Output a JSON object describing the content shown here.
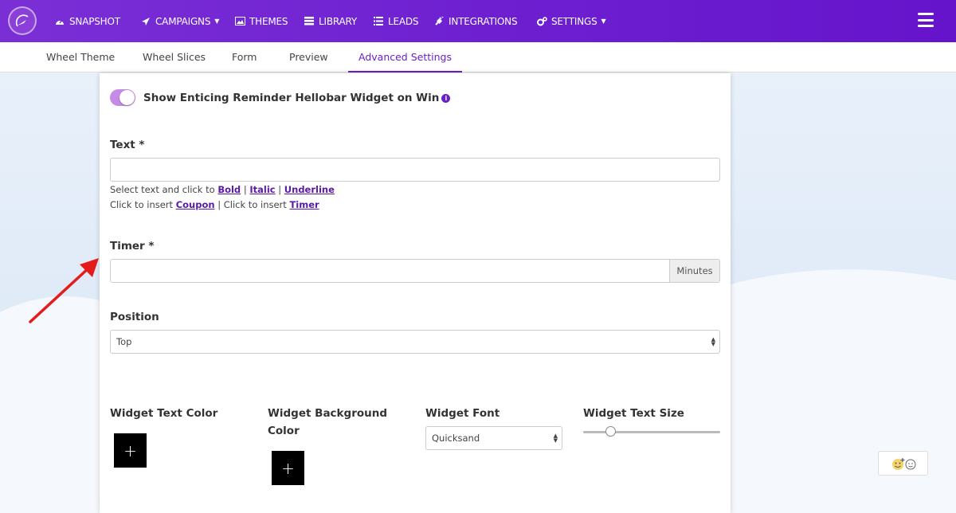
{
  "nav": {
    "items": [
      {
        "label": "SNAPSHOT",
        "icon": "dashboard-icon"
      },
      {
        "label": "CAMPAIGNS",
        "icon": "paper-plane-icon",
        "dropdown": true
      },
      {
        "label": "THEMES",
        "icon": "image-icon"
      },
      {
        "label": "LIBRARY",
        "icon": "list-icon"
      },
      {
        "label": "LEADS",
        "icon": "list-lines-icon"
      },
      {
        "label": "INTEGRATIONS",
        "icon": "plug-icon"
      },
      {
        "label": "SETTINGS",
        "icon": "gears-icon",
        "dropdown": true
      }
    ]
  },
  "tabs": {
    "items": [
      {
        "label": "Wheel Theme"
      },
      {
        "label": "Wheel Slices"
      },
      {
        "label": "Form"
      },
      {
        "label": "Preview"
      },
      {
        "label": "Advanced Settings",
        "active": true
      }
    ]
  },
  "form": {
    "toggle_label": "Show Enticing Reminder Hellobar Widget on Win",
    "info_glyph": "i",
    "text": {
      "label": "Text *",
      "value": "",
      "helper1_prefix": "Select text and click to ",
      "bold": "Bold",
      "italic": "Italic",
      "underline": "Underline",
      "separator": " | ",
      "helper2_prefix": "Click to insert ",
      "coupon": "Coupon",
      "helper2_mid": " | Click to insert ",
      "timer": "Timer"
    },
    "timer": {
      "label": "Timer *",
      "value": "",
      "addon": "Minutes"
    },
    "position": {
      "label": "Position",
      "selected": "Top"
    },
    "widget_text_color": {
      "label": "Widget Text Color",
      "button": "+"
    },
    "widget_bg_color": {
      "label_line1": "Widget Background",
      "label_line2": "Color",
      "button": "+"
    },
    "widget_font": {
      "label": "Widget Font",
      "selected": "Quicksand"
    },
    "widget_text_size": {
      "label": "Widget Text Size",
      "value_fraction": 0.2
    }
  },
  "colors": {
    "accent": "#6a1fc9",
    "nav_bg": "#6d1fd0",
    "toggle_on": "#c58be6",
    "annotation_arrow": "#e31b1b"
  }
}
